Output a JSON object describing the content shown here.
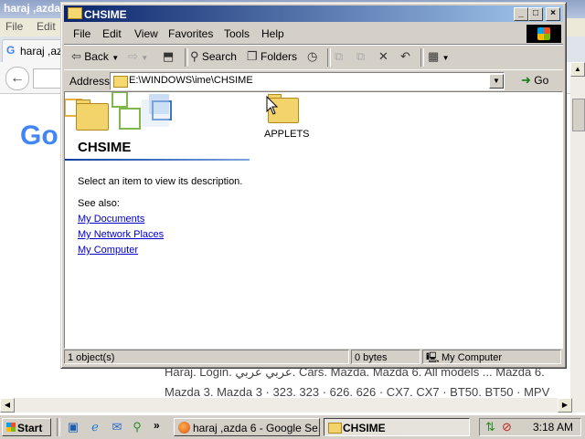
{
  "background_browser": {
    "title": "haraj ,azda",
    "menu": [
      "File",
      "Edit"
    ],
    "tab_label": "haraj ,az",
    "logo_text": "Go",
    "results": [
      "Haraj. Login. عربي عربي. Cars. Mazda. Mazda 6. All models ... Mazda 6.",
      "Mazda 3. Mazda 3 · 323. 323 · 626. 626 · CX7. CX7 · BT50. BT50 · MPV"
    ]
  },
  "explorer": {
    "title": "CHSIME",
    "window_buttons": [
      "_",
      "□",
      "×"
    ],
    "menu": [
      "File",
      "Edit",
      "View",
      "Favorites",
      "Tools",
      "Help"
    ],
    "toolbar": {
      "back": "Back",
      "search": "Search",
      "folders": "Folders"
    },
    "address": {
      "label": "Address",
      "value": "E:\\WINDOWS\\ime\\CHSIME",
      "go": "Go"
    },
    "panel": {
      "title": "CHSIME",
      "description": "Select an item to view its description.",
      "see_also": "See also:",
      "links": [
        "My Documents",
        "My Network Places",
        "My Computer"
      ]
    },
    "items": [
      {
        "label": "APPLETS",
        "icon": "folder-icon"
      }
    ],
    "status": {
      "objects": "1 object(s)",
      "size": "0 bytes",
      "zone": "My Computer"
    }
  },
  "taskbar": {
    "start": "Start",
    "quick_launch": [
      "desktop-icon",
      "ie-icon",
      "outlook-icon",
      "search-icon"
    ],
    "chevron": "»",
    "tasks": [
      {
        "label": "haraj ,azda 6 - Google Se...",
        "active": false
      },
      {
        "label": "CHSIME",
        "active": true
      }
    ],
    "clock": "3:18 AM"
  }
}
